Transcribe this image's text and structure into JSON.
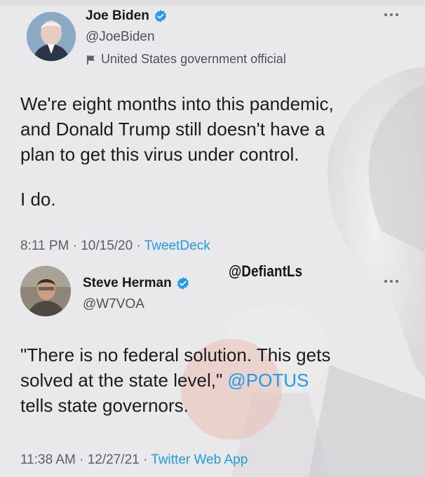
{
  "tweet1": {
    "name": "Joe Biden",
    "handle": "@JoeBiden",
    "label": "United States government official",
    "text": "We're eight months into this pandemic,\nand Donald Trump still doesn't have a\nplan to get this virus under control.",
    "text2": "I do.",
    "time": "8:11 PM · 10/15/20 · ",
    "source": "TweetDeck"
  },
  "tweet2": {
    "name": "Steve Herman",
    "handle": "@W7VOA",
    "text_before": "\"There is no federal solution. This gets\nsolved at the state level,\" ",
    "mention": "@POTUS",
    "text_after": "\ntells state governors.",
    "time": "11:38 AM · 12/27/21 · ",
    "source": "Twitter Web App"
  },
  "watermark": "@DefiantLs",
  "colors": {
    "accent": "#1d9bf0",
    "verified": "#1d9bf0",
    "background": "#e9e8ea"
  },
  "icons": {
    "verified": "verified-badge-icon",
    "flag": "government-flag-icon",
    "more": "more-options-icon"
  }
}
